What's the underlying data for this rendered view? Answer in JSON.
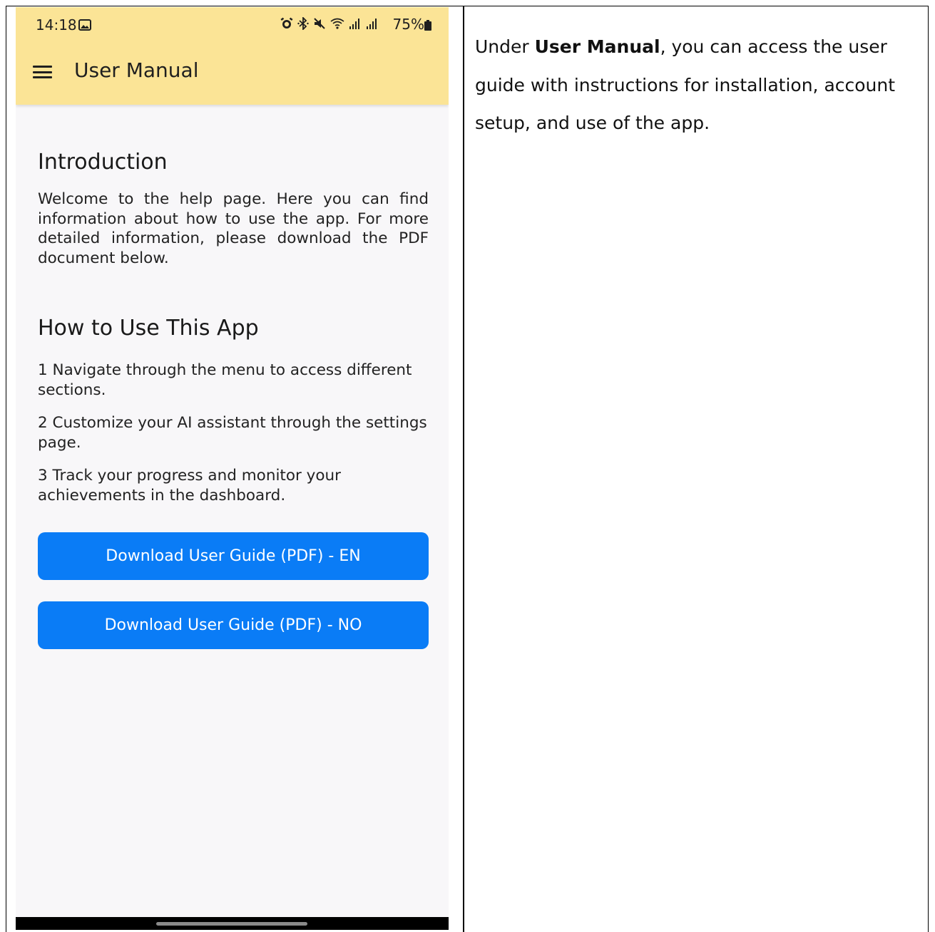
{
  "status_bar": {
    "time": "14:18",
    "battery": "75%"
  },
  "appbar": {
    "title": "User Manual"
  },
  "introduction": {
    "heading": "Introduction",
    "text": "Welcome to the help page. Here you can find information about how to use the app. For more detailed information, please download the PDF document below."
  },
  "how_to": {
    "heading": "How to Use This App",
    "steps": [
      "1 Navigate through the menu to access different sections.",
      "2 Customize your AI assistant through the settings page.",
      "3 Track your progress and monitor your achievements in the dashboard."
    ]
  },
  "buttons": {
    "download_en": "Download User Guide (PDF) - EN",
    "download_no": "Download User Guide (PDF) - NO"
  },
  "description": {
    "prefix": "Under ",
    "bold": "User Manual",
    "suffix": ", you can access the user guide with instructions for installation, account setup, and use of the app."
  },
  "colors": {
    "appbar": "#fbe496",
    "button": "#0a7cf6",
    "background": "#f8f7f9"
  }
}
